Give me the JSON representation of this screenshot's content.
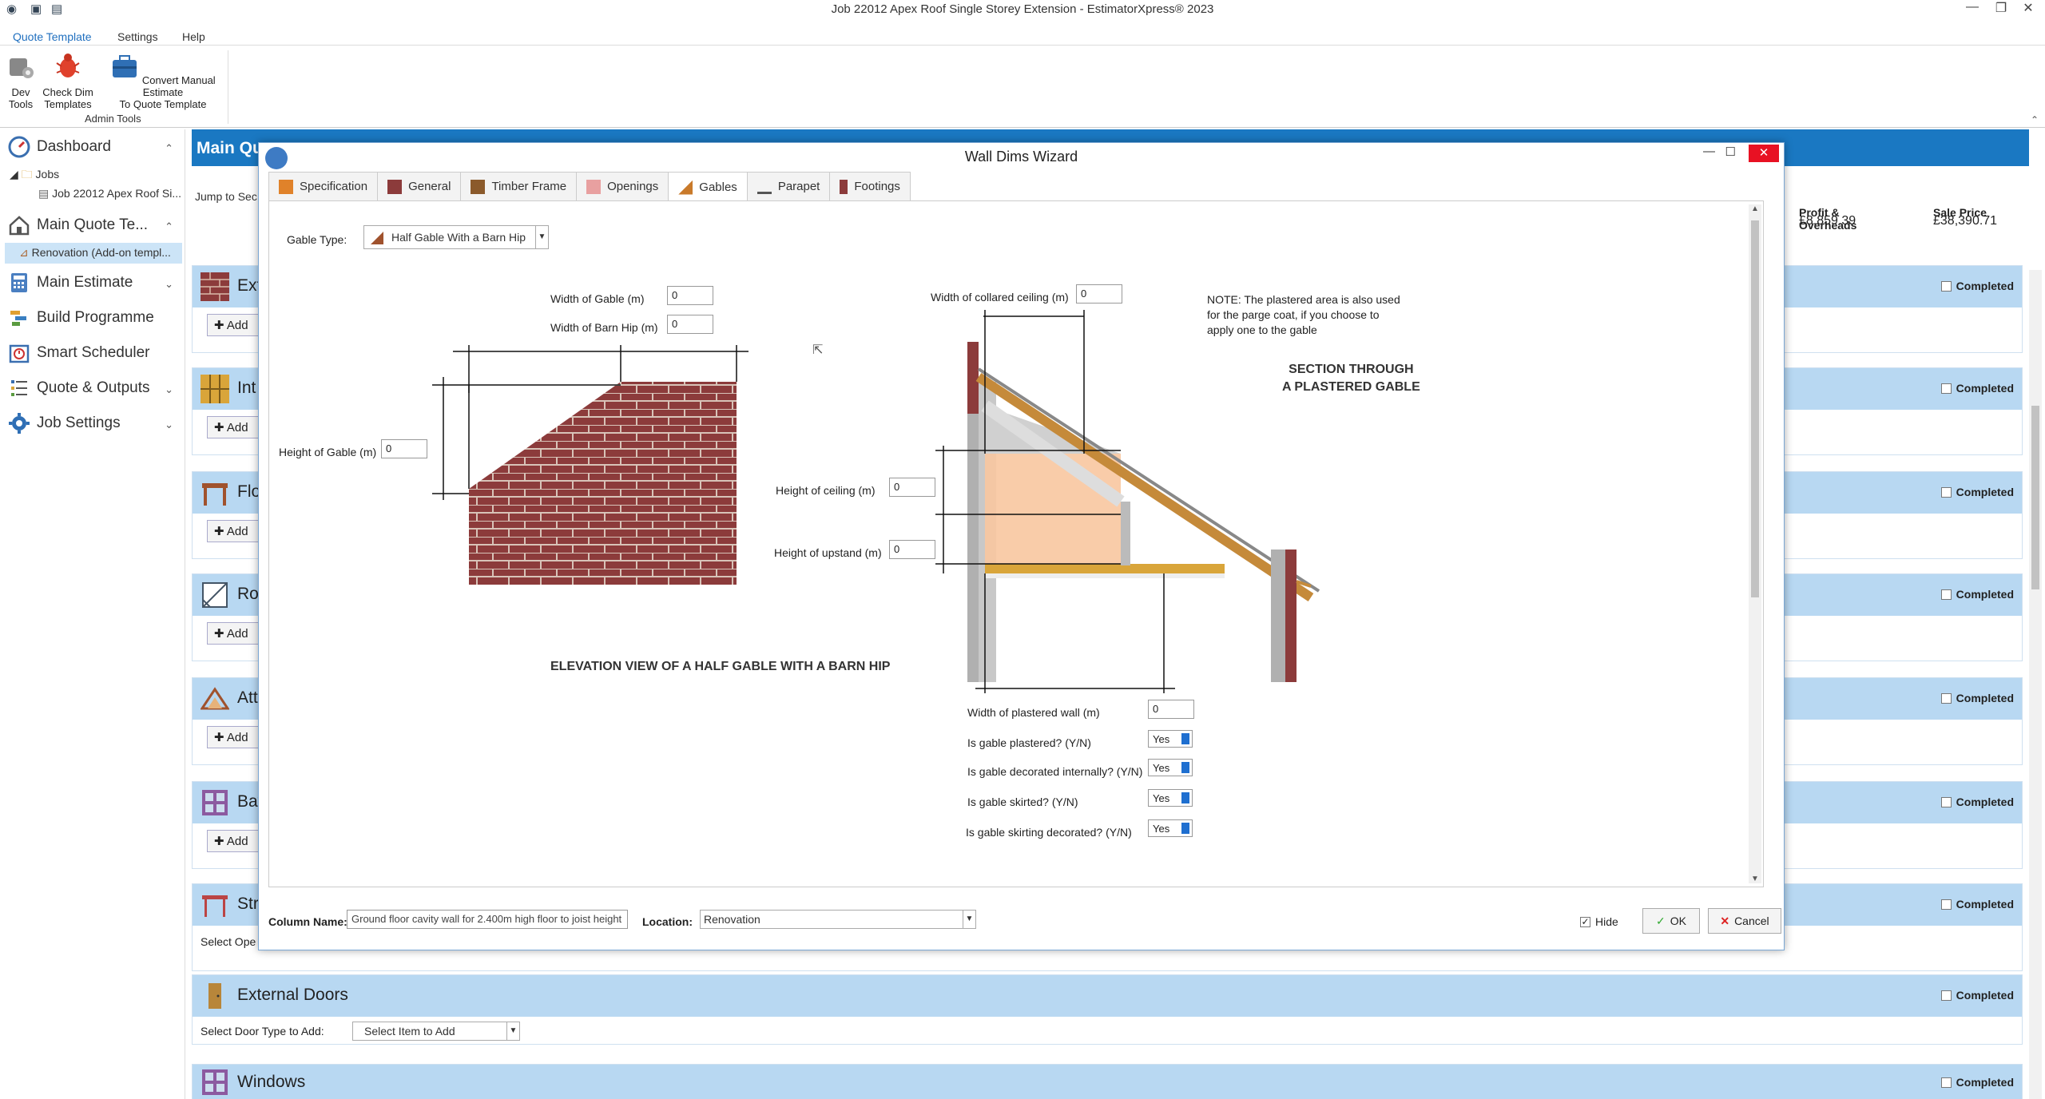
{
  "window": {
    "title": "Job 22012 Apex Roof Single Storey Extension - EstimatorXpress® 2023"
  },
  "ribbon": {
    "tabs": [
      "Quote Template",
      "Settings",
      "Help"
    ],
    "buttons": [
      {
        "label": "Dev\nTools"
      },
      {
        "label": "Check Dim\nTemplates"
      },
      {
        "label": "Convert Manual Estimate\nTo Quote Template"
      }
    ],
    "group_label": "Admin Tools"
  },
  "nav": {
    "dashboard": "Dashboard",
    "jobs": "Jobs",
    "job_item": "Job 22012 Apex Roof Si...",
    "main_quote": "Main Quote Te...",
    "renovation": "Renovation (Add-on templ...",
    "main_estimate": "Main Estimate",
    "build_programme": "Build Programme",
    "smart_scheduler": "Smart Scheduler",
    "quote_outputs": "Quote & Outputs",
    "job_settings": "Job Settings"
  },
  "main": {
    "header": "Main Qu",
    "jump_to": "Jump to Sec",
    "profit_label": "Profit & Overheads",
    "profit_value": "£8,859.39",
    "sale_label": "Sale Price",
    "sale_value": "£38,390.71",
    "completed_label": "Completed",
    "add_label": "Add",
    "sections": [
      {
        "title": "Ext"
      },
      {
        "title": "Int"
      },
      {
        "title": "Flo"
      },
      {
        "title": "Ro"
      },
      {
        "title": "Att"
      },
      {
        "title": "Bay"
      },
      {
        "title": "Str"
      },
      {
        "title": "External Doors"
      },
      {
        "title": "Windows"
      }
    ],
    "str_select": "Select Ope",
    "doors_select_label": "Select Door Type to Add:",
    "doors_select_value": "Select Item to Add"
  },
  "dialog": {
    "title": "Wall Dims Wizard",
    "tabs": [
      "Specification",
      "General",
      "Timber Frame",
      "Openings",
      "Gables",
      "Parapet",
      "Footings"
    ],
    "active_tab": "Gables",
    "gable_type_label": "Gable Type:",
    "gable_type_value": "Half Gable With a Barn Hip",
    "fields": {
      "width_of_gable": {
        "label": "Width of Gable (m)",
        "value": "0"
      },
      "width_of_barn_hip": {
        "label": "Width of Barn Hip (m)",
        "value": "0"
      },
      "height_of_gable": {
        "label": "Height of Gable (m)",
        "value": "0"
      },
      "width_collared_ceiling": {
        "label": "Width of collared ceiling (m)",
        "value": "0"
      },
      "height_of_ceiling": {
        "label": "Height of ceiling (m)",
        "value": "0"
      },
      "height_of_upstand": {
        "label": "Height of upstand (m)",
        "value": "0"
      },
      "width_plastered_wall": {
        "label": "Width of plastered wall (m)",
        "value": "0"
      }
    },
    "yn": [
      {
        "label": "Is gable plastered? (Y/N)",
        "value": "Yes"
      },
      {
        "label": "Is gable decorated internally? (Y/N)",
        "value": "Yes"
      },
      {
        "label": "Is gable skirted? (Y/N)",
        "value": "Yes"
      },
      {
        "label": "Is gable skirting decorated? (Y/N)",
        "value": "Yes"
      }
    ],
    "note": "NOTE: The plastered area is also used for the parge coat, if you choose to apply one to the gable",
    "section_caption": "SECTION THROUGH\nA PLASTERED GABLE",
    "elevation_caption": "ELEVATION VIEW OF A HALF\nGABLE WITH A BARN HIP",
    "column_name_label": "Column Name:",
    "column_name_value": "Ground floor cavity wall for 2.400m high floor to joist height",
    "location_label": "Location:",
    "location_value": "Renovation",
    "hide_label": "Hide",
    "ok_label": "OK",
    "cancel_label": "Cancel"
  },
  "colors": {
    "accent": "#1a78c2",
    "section_bar": "#b8d8f2",
    "brick": "#8c3b3b"
  }
}
